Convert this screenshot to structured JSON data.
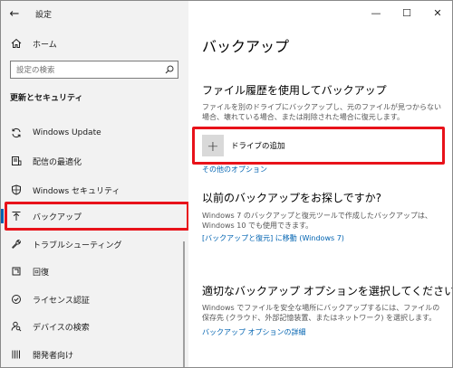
{
  "titlebar": {
    "app_title": "設定"
  },
  "nav": {
    "home_label": "ホーム",
    "search_placeholder": "設定の検索",
    "section_title": "更新とセキュリティ",
    "items": [
      {
        "label": "Windows Update",
        "icon": "sync-icon"
      },
      {
        "label": "配信の最適化",
        "icon": "delivery-optimization-icon"
      },
      {
        "label": "Windows セキュリティ",
        "icon": "shield-icon"
      },
      {
        "label": "バックアップ",
        "icon": "backup-arrow-icon",
        "selected": true
      },
      {
        "label": "トラブルシューティング",
        "icon": "wrench-icon"
      },
      {
        "label": "回復",
        "icon": "recovery-icon"
      },
      {
        "label": "ライセンス認証",
        "icon": "check-circle-icon"
      },
      {
        "label": "デバイスの検索",
        "icon": "person-search-icon"
      },
      {
        "label": "開発者向け",
        "icon": "developer-icon"
      }
    ]
  },
  "window_controls": {
    "minimize": "—",
    "maximize": "☐",
    "close": "✕"
  },
  "main": {
    "title": "バックアップ",
    "file_history": {
      "heading": "ファイル履歴を使用してバックアップ",
      "description": "ファイルを別のドライブにバックアップし、元のファイルが見つからない場合、壊れている場合、または削除された場合に復元します。",
      "add_drive_label": "ドライブの追加",
      "more_options": "その他のオプション"
    },
    "older_backup": {
      "heading": "以前のバックアップをお探しですか?",
      "description": "Windows 7 のバックアップと復元ツールで作成したバックアップは、Windows 10 でも使用できます。",
      "link": "[バックアップと復元] に移動 (Windows 7)"
    },
    "options": {
      "heading": "適切なバックアップ オプションを選択してください",
      "description": "Windows でファイルを安全な場所にバックアップするには、ファイルの保存先 (クラウド、外部記憶装置、またはネットワーク) を選択します。",
      "link": "バックアップ オプションの詳細"
    }
  },
  "colors": {
    "accent": "#0063b1",
    "highlight": "#e8121a",
    "sidebar_bg": "#f2f2f2"
  }
}
